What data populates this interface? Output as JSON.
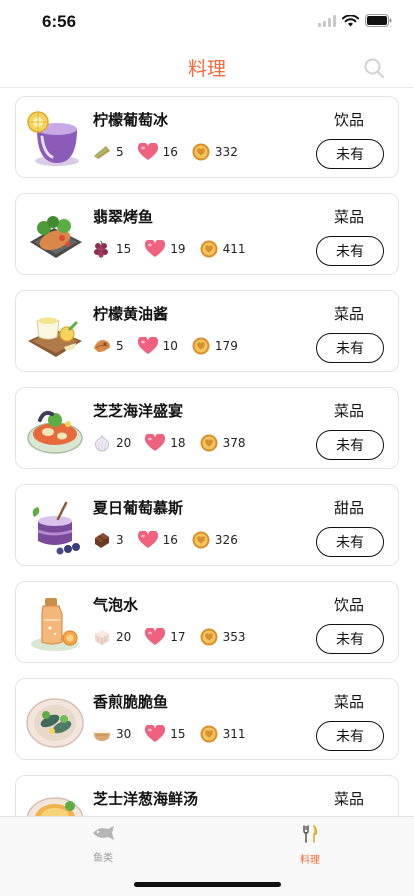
{
  "status": {
    "time": "6:56"
  },
  "nav": {
    "title": "料理"
  },
  "dishes": [
    {
      "name": "柠檬葡萄冰",
      "category": "饮品",
      "ingredient_count": "5",
      "hearts": "16",
      "coins": "332",
      "own_label": "未有",
      "ingredient_icon": "bread-icon",
      "dish_icon": "grape-ice-drink-icon"
    },
    {
      "name": "翡翠烤鱼",
      "category": "菜品",
      "ingredient_count": "15",
      "hearts": "19",
      "coins": "411",
      "own_label": "未有",
      "ingredient_icon": "grapes-icon",
      "dish_icon": "grilled-fish-icon"
    },
    {
      "name": "柠檬黄油酱",
      "category": "菜品",
      "ingredient_count": "5",
      "hearts": "10",
      "coins": "179",
      "own_label": "未有",
      "ingredient_icon": "clam-icon",
      "dish_icon": "lemon-butter-sauce-icon"
    },
    {
      "name": "芝芝海洋盛宴",
      "category": "菜品",
      "ingredient_count": "20",
      "hearts": "18",
      "coins": "378",
      "own_label": "未有",
      "ingredient_icon": "garlic-icon",
      "dish_icon": "seafood-feast-icon"
    },
    {
      "name": "夏日葡萄慕斯",
      "category": "甜品",
      "ingredient_count": "3",
      "hearts": "16",
      "coins": "326",
      "own_label": "未有",
      "ingredient_icon": "chocolate-icon",
      "dish_icon": "grape-mousse-icon"
    },
    {
      "name": "气泡水",
      "category": "饮品",
      "ingredient_count": "20",
      "hearts": "17",
      "coins": "353",
      "own_label": "未有",
      "ingredient_icon": "sugar-cube-icon",
      "dish_icon": "sparkling-water-icon"
    },
    {
      "name": "香煎脆脆鱼",
      "category": "菜品",
      "ingredient_count": "30",
      "hearts": "15",
      "coins": "311",
      "own_label": "未有",
      "ingredient_icon": "rice-bowl-icon",
      "dish_icon": "pan-fried-fish-icon"
    },
    {
      "name": "芝士洋葱海鲜汤",
      "category": "菜品",
      "ingredient_count": "",
      "hearts": "",
      "coins": "",
      "own_label": "",
      "ingredient_icon": "",
      "dish_icon": "onion-seafood-soup-icon"
    }
  ],
  "tabs": [
    {
      "label": "鱼类",
      "icon": "fish-icon",
      "active": false
    },
    {
      "label": "料理",
      "icon": "utensils-icon",
      "active": true
    }
  ],
  "colors": {
    "accent": "#f26b3a",
    "heart": "#f0607f",
    "coin": "#e2a23c",
    "inactive_tab": "#9a9a9a"
  }
}
